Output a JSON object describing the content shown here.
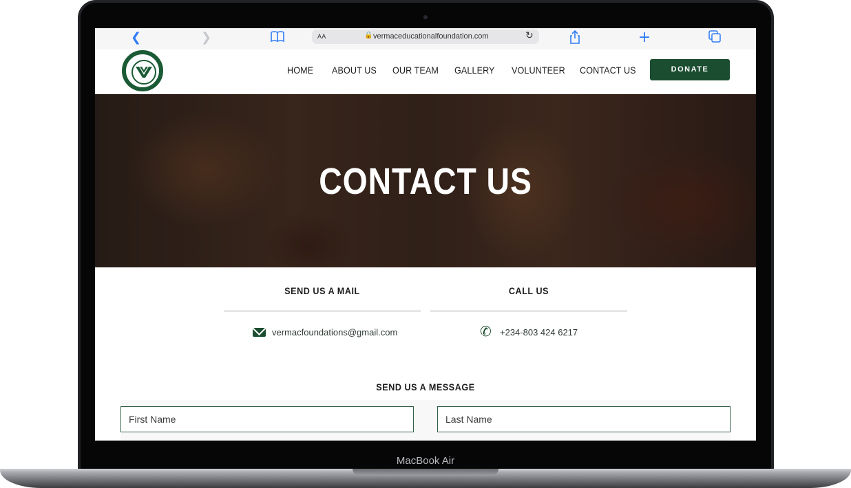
{
  "device": {
    "label": "MacBook Air"
  },
  "browser": {
    "reader_label": "AA",
    "url": "vermaceducationalfoundation.com"
  },
  "header": {
    "logo_alt": "Vermac Educational Foundation",
    "nav": [
      {
        "label": "HOME"
      },
      {
        "label": "ABOUT US"
      },
      {
        "label": "OUR TEAM"
      },
      {
        "label": "GALLERY"
      },
      {
        "label": "VOLUNTEER"
      },
      {
        "label": "CONTACT US"
      }
    ],
    "donate_label": "DONATE"
  },
  "hero": {
    "title": "CONTACT US"
  },
  "contact": {
    "mail": {
      "heading": "SEND US A MAIL",
      "value": "vermacfoundations@gmail.com"
    },
    "call": {
      "heading": "CALL US",
      "value": "+234-803 424 6217"
    }
  },
  "form": {
    "heading": "SEND US A MESSAGE",
    "first_name_placeholder": "First Name",
    "last_name_placeholder": "Last Name"
  },
  "colors": {
    "brand_green": "#1b4d30",
    "accent_blue": "#2f7cf6"
  }
}
